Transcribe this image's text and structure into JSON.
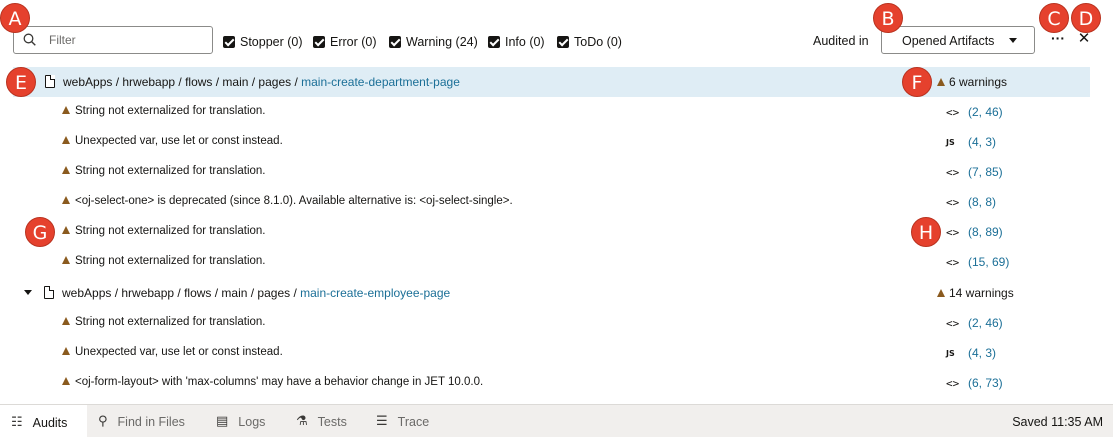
{
  "filter": {
    "placeholder": "Filter",
    "value": ""
  },
  "checks": [
    {
      "label": "Stopper (0)"
    },
    {
      "label": "Error (0)"
    },
    {
      "label": "Warning (24)"
    },
    {
      "label": "Info (0)"
    },
    {
      "label": "ToDo (0)"
    }
  ],
  "audited_in_label": "Audited in",
  "scope_dropdown": {
    "selected": "Opened Artifacts"
  },
  "more_label": "···",
  "close_label": "✕",
  "groups": [
    {
      "path_prefix": "webApps / hrwebapp / flows / main / pages / ",
      "path_link": "main-create-department-page",
      "count": "6 warnings",
      "items": [
        {
          "message": "String not externalized for translation.",
          "icon": "<>",
          "location": "(2, 46)"
        },
        {
          "message": "Unexpected var, use let or const instead.",
          "icon": "JS",
          "location": "(4, 3)"
        },
        {
          "message": "String not externalized for translation.",
          "icon": "<>",
          "location": "(7, 85)"
        },
        {
          "message": "<oj-select-one> is deprecated (since 8.1.0). Available alternative is: <oj-select-single>.",
          "icon": "<>",
          "location": "(8, 8)"
        },
        {
          "message": "String not externalized for translation.",
          "icon": "<>",
          "location": "(8, 89)"
        },
        {
          "message": "String not externalized for translation.",
          "icon": "<>",
          "location": "(15, 69)"
        }
      ]
    },
    {
      "path_prefix": "webApps / hrwebapp / flows / main / pages / ",
      "path_link": "main-create-employee-page",
      "count": "14 warnings",
      "items": [
        {
          "message": "String not externalized for translation.",
          "icon": "<>",
          "location": "(2, 46)"
        },
        {
          "message": "Unexpected var, use let or const instead.",
          "icon": "JS",
          "location": "(4, 3)"
        },
        {
          "message": "<oj-form-layout> with 'max-columns' may have a behavior change in JET 10.0.0.",
          "icon": "<>",
          "location": "(6, 73)"
        }
      ]
    }
  ],
  "tabs": [
    {
      "label": "Audits",
      "icon": "audits-icon"
    },
    {
      "label": "Find in Files",
      "icon": "search-icon"
    },
    {
      "label": "Logs",
      "icon": "logs-icon"
    },
    {
      "label": "Tests",
      "icon": "flask-icon"
    },
    {
      "label": "Trace",
      "icon": "trace-icon"
    }
  ],
  "status": "Saved 11:35 AM",
  "callouts": {
    "a": "A",
    "b": "B",
    "c": "C",
    "d": "D",
    "e": "E",
    "f": "F",
    "g": "G",
    "h": "H"
  },
  "colors": {
    "callout": "#e5412d",
    "selected_row": "#dfedf5",
    "link": "#1b6f97",
    "warning": "#8a5a1e"
  }
}
